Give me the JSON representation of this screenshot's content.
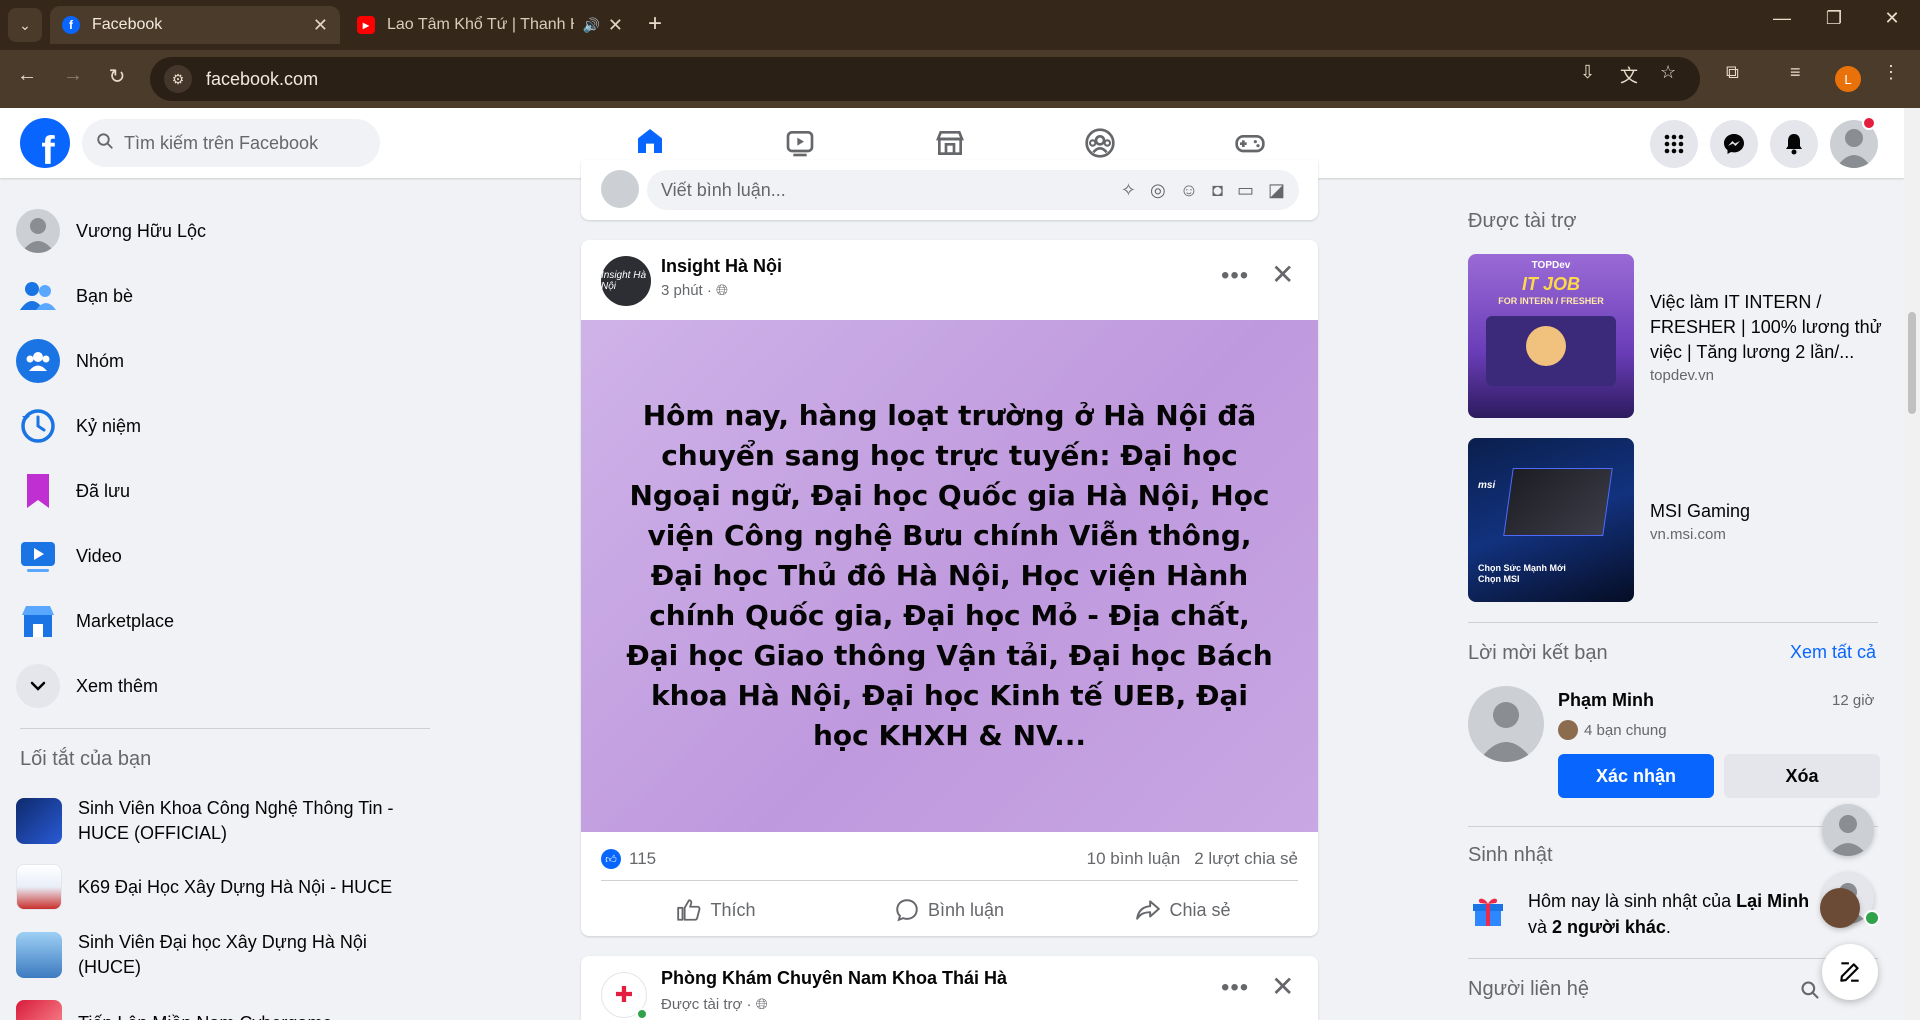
{
  "browser": {
    "tabs": [
      {
        "title": "Facebook",
        "active": true
      },
      {
        "title": "Lao Tâm Khổ Tứ | Thanh Hư",
        "active": false
      }
    ],
    "url": "facebook.com",
    "profile_initial": "L"
  },
  "fb_nav": {
    "search_placeholder": "Tìm kiếm trên Facebook",
    "tabs": [
      "home-icon",
      "video-icon",
      "marketplace-icon",
      "groups-icon",
      "gaming-icon"
    ],
    "active_tab": "home-icon"
  },
  "sidebar": {
    "items": [
      {
        "label": "Vương Hữu Lộc",
        "icon": "profile-avatar"
      },
      {
        "label": "Bạn bè",
        "icon": "friends-icon"
      },
      {
        "label": "Nhóm",
        "icon": "groups-icon"
      },
      {
        "label": "Kỷ niệm",
        "icon": "memories-icon"
      },
      {
        "label": "Đã lưu",
        "icon": "saved-icon"
      },
      {
        "label": "Video",
        "icon": "video-icon"
      },
      {
        "label": "Marketplace",
        "icon": "marketplace-icon"
      },
      {
        "label": "Xem thêm",
        "icon": "chevron-down-icon"
      }
    ],
    "shortcuts_heading": "Lối tắt của bạn",
    "shortcuts": [
      {
        "label": "Sinh Viên Khoa Công Nghệ Thông Tin - HUCE (OFFICIAL)"
      },
      {
        "label": "K69 Đại Học Xây Dựng Hà Nội - HUCE"
      },
      {
        "label": "Sinh Viên Đại học Xây Dựng Hà Nội (HUCE)"
      },
      {
        "label": "Tiến Lên Miền Nam Cybergame"
      }
    ]
  },
  "feed": {
    "comment_placeholder": "Viết bình luận...",
    "post": {
      "author": "Insight Hà Nội",
      "avatar_text": "Insight Hà Nội",
      "time": "3 phút ·",
      "text": "Hôm nay, hàng loạt trường ở Hà Nội đã chuyển sang học trực tuyến: Đại học Ngoại ngữ, Đại học Quốc gia Hà Nội, Học viện Công nghệ Bưu chính Viễn thông, Đại học Thủ đô Hà Nội, Học viện Hành chính Quốc gia, Đại học Mỏ - Địa chất, Đại học Giao thông Vận tải, Đại học Bách khoa Hà Nội, Đại học Kinh tế UEB, Đại học KHXH & NV...",
      "likes": "115",
      "comments": "10 bình luận",
      "shares": "2 lượt chia sẻ",
      "actions": {
        "like": "Thích",
        "comment": "Bình luận",
        "share": "Chia sẻ"
      }
    },
    "post2": {
      "author": "Phòng Khám Chuyên Nam Khoa Thái Hà",
      "meta": "Được tài trợ ·"
    }
  },
  "right": {
    "sponsored_heading": "Được tài trợ",
    "ads": [
      {
        "title": "Việc làm IT INTERN / FRESHER | 100% lương thử việc | Tăng lương 2 lần/...",
        "domain": "topdev.vn",
        "image_brand": "TOPDev",
        "image_headline": "IT JOB",
        "image_sub": "FOR INTERN / FRESHER"
      },
      {
        "title": "MSI Gaming",
        "domain": "vn.msi.com",
        "image_brand": "msi",
        "image_line1": "Chọn Sức Mạnh Mới",
        "image_line2": "Chọn MSI"
      }
    ],
    "friend_requests_heading": "Lời mời kết bạn",
    "see_all": "Xem tất cả",
    "friend_request": {
      "name": "Phạm Minh",
      "time": "12 giờ",
      "mutual": "4 bạn chung",
      "confirm": "Xác nhận",
      "delete": "Xóa"
    },
    "birthdays_heading": "Sinh nhật",
    "birthday": {
      "prefix": "Hôm nay là sinh nhật của ",
      "name": "Lại Minh",
      "middle": "và ",
      "others": "2 người khác",
      "suffix": "."
    },
    "contacts_heading": "Người liên hệ"
  },
  "colors": {
    "fb_blue": "#0866ff",
    "chrome_dark": "#35281a",
    "post_bg": "#c5a3e2"
  }
}
